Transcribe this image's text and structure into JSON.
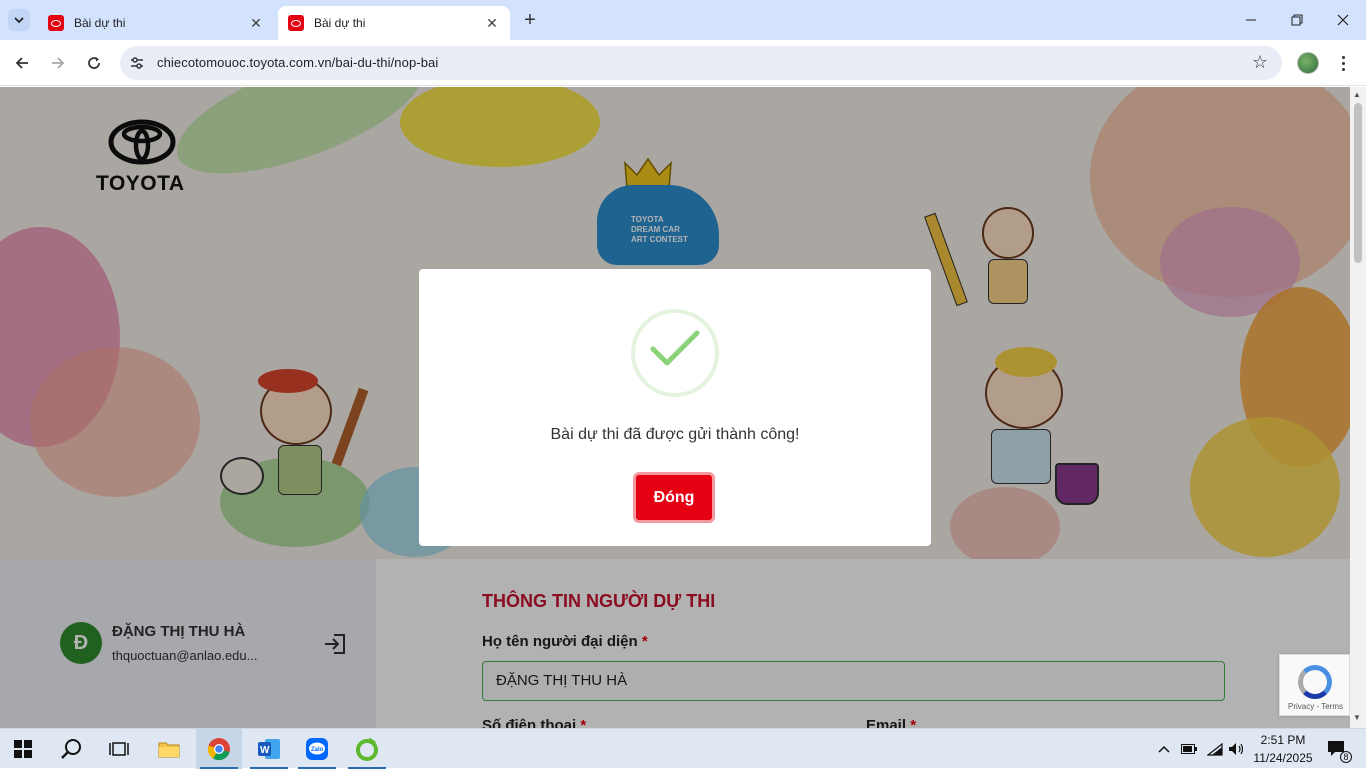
{
  "browser": {
    "tabs": [
      {
        "title": "Bài dự thi",
        "active": false
      },
      {
        "title": "Bài dự thi",
        "active": true
      }
    ],
    "url": "chiecotomouoc.toyota.com.vn/bai-du-thi/nop-bai"
  },
  "banner": {
    "brand": "TOYOTA",
    "badge_lines": [
      "TOYOTA",
      "DREAM CAR",
      "ART CONTEST"
    ]
  },
  "profile": {
    "initial": "Đ",
    "name": "ĐẶNG THỊ THU HÀ",
    "email": "thquoctuan@anlao.edu..."
  },
  "form": {
    "section_title": "THÔNG TIN NGƯỜI DỰ THI",
    "rep_name_label": "Họ tên người đại diện",
    "rep_name_value": "ĐẶNG THỊ THU HÀ",
    "phone_label": "Số điện thoại",
    "email_label": "Email",
    "required_mark": "*"
  },
  "modal": {
    "message": "Bài dự thi đã được gửi thành công!",
    "close_label": "Đóng"
  },
  "recaptcha": {
    "links": "Privacy - Terms"
  },
  "taskbar": {
    "time": "2:51 PM",
    "date": "11/24/2025",
    "notification_count": "8"
  },
  "colors": {
    "brand_red": "#e50012",
    "section_red": "#c8102e",
    "success_green": "#8bd37a"
  }
}
